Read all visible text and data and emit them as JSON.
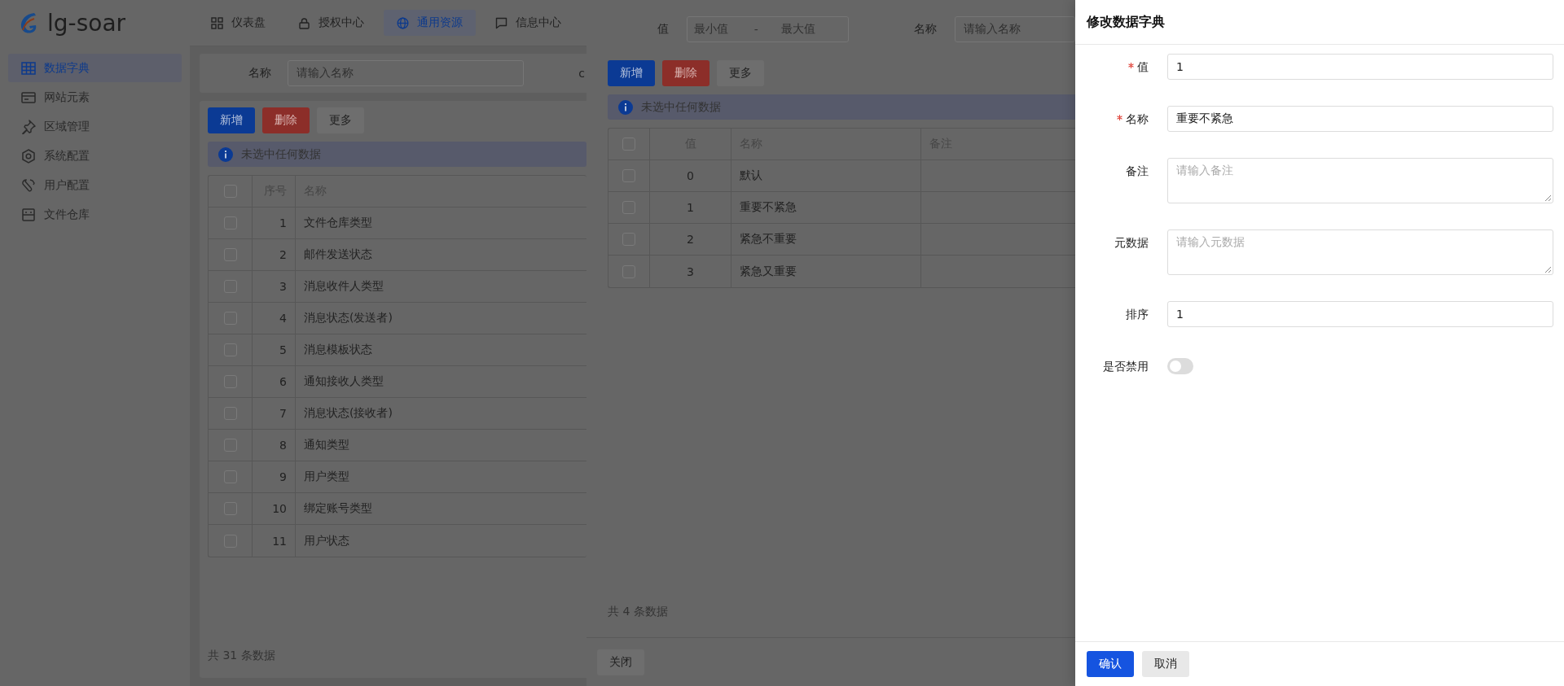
{
  "header": {
    "logo_text": "lg-soar",
    "nav": [
      {
        "label": "仪表盘",
        "selected": false
      },
      {
        "label": "授权中心",
        "selected": false
      },
      {
        "label": "通用资源",
        "selected": true
      },
      {
        "label": "信息中心",
        "selected": false
      }
    ]
  },
  "sidebar": {
    "items": [
      {
        "label": "数据字典",
        "selected": true
      },
      {
        "label": "网站元素",
        "selected": false
      },
      {
        "label": "区域管理",
        "selected": false
      },
      {
        "label": "系统配置",
        "selected": false
      },
      {
        "label": "用户配置",
        "selected": false
      },
      {
        "label": "文件仓库",
        "selected": false
      }
    ]
  },
  "filter": {
    "label": "名称",
    "placeholder": "请输入名称",
    "cut_label": "c"
  },
  "list": {
    "buttons": [
      {
        "label": "新增",
        "kind": "primary"
      },
      {
        "label": "删除",
        "kind": "danger"
      },
      {
        "label": "更多",
        "kind": "default"
      }
    ],
    "alert": "未选中任何数据",
    "all_checked": false,
    "columns": [
      "序号",
      "名称"
    ],
    "rows": [
      {
        "index": "1",
        "name": "文件仓库类型",
        "checked": false
      },
      {
        "index": "2",
        "name": "邮件发送状态",
        "checked": false
      },
      {
        "index": "3",
        "name": "消息收件人类型",
        "checked": false
      },
      {
        "index": "4",
        "name": "消息状态(发送者)",
        "checked": false
      },
      {
        "index": "5",
        "name": "消息模板状态",
        "checked": false
      },
      {
        "index": "6",
        "name": "通知接收人类型",
        "checked": false
      },
      {
        "index": "7",
        "name": "消息状态(接收者)",
        "checked": false
      },
      {
        "index": "8",
        "name": "通知类型",
        "checked": false
      },
      {
        "index": "9",
        "name": "用户类型",
        "checked": false
      },
      {
        "index": "10",
        "name": "绑定账号类型",
        "checked": false
      },
      {
        "index": "11",
        "name": "用户状态",
        "checked": false
      }
    ],
    "total": "共 31 条数据"
  },
  "values_drawer": {
    "filters": [
      {
        "kind": "range",
        "label": "值",
        "min_placeholder": "最小值",
        "separator": "-",
        "max_placeholder": "最大值"
      },
      {
        "kind": "text",
        "label": "名称",
        "placeholder": "请输入名称"
      }
    ],
    "buttons": [
      {
        "label": "新增",
        "kind": "primary"
      },
      {
        "label": "删除",
        "kind": "danger"
      },
      {
        "label": "更多",
        "kind": "default"
      }
    ],
    "alert": "未选中任何数据",
    "all_checked": false,
    "columns": [
      "值",
      "名称",
      "备注"
    ],
    "rows": [
      {
        "value": "0",
        "name": "默认",
        "checked": false
      },
      {
        "value": "1",
        "name": "重要不紧急",
        "checked": false
      },
      {
        "value": "2",
        "name": "紧急不重要",
        "checked": false
      },
      {
        "value": "3",
        "name": "紧急又重要",
        "checked": false
      }
    ],
    "total": "共 4 条数据",
    "close_button": "关闭"
  },
  "edit_drawer": {
    "title": "修改数据字典",
    "fields": [
      {
        "kind": "input",
        "label": "值",
        "required": true,
        "value": "1"
      },
      {
        "kind": "input",
        "label": "名称",
        "required": true,
        "value": "重要不紧急"
      },
      {
        "kind": "textarea",
        "label": "备注",
        "required": false,
        "placeholder": "请输入备注"
      },
      {
        "kind": "textarea",
        "label": "元数据",
        "required": false,
        "placeholder": "请输入元数据"
      },
      {
        "kind": "input",
        "label": "排序",
        "required": false,
        "value": "1"
      },
      {
        "kind": "switch",
        "label": "是否禁用",
        "required": false,
        "on": false
      }
    ],
    "buttons": [
      {
        "label": "确认",
        "kind": "primary"
      },
      {
        "label": "取消",
        "kind": "default"
      }
    ]
  }
}
